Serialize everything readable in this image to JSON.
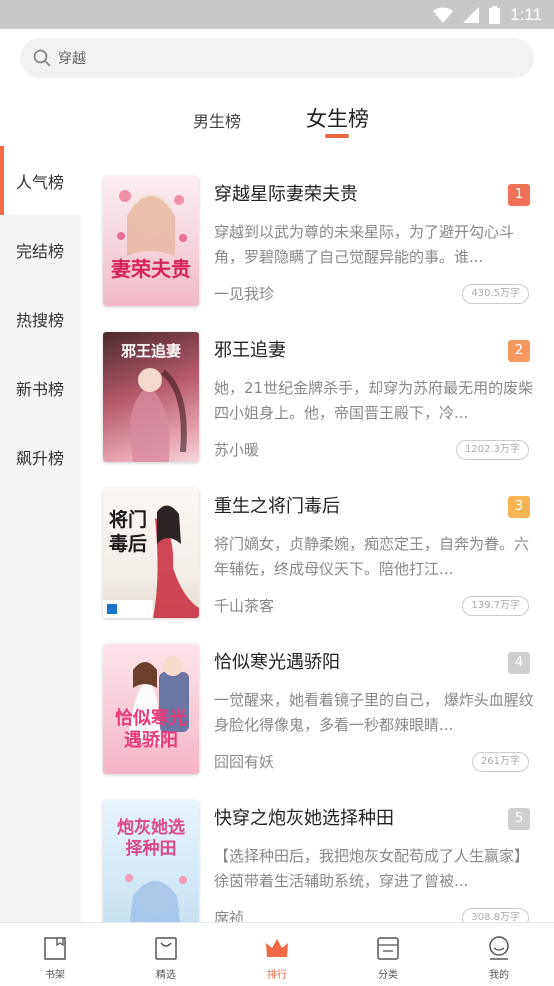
{
  "status_bar": {
    "time": "1:11"
  },
  "search": {
    "placeholder": "穿越"
  },
  "tabs": [
    {
      "label": "男生榜",
      "active": false
    },
    {
      "label": "女生榜",
      "active": true
    }
  ],
  "sidebar": {
    "items": [
      {
        "label": "人气榜",
        "active": true
      },
      {
        "label": "完结榜",
        "active": false
      },
      {
        "label": "热搜榜",
        "active": false
      },
      {
        "label": "新书榜",
        "active": false
      },
      {
        "label": "飙升榜",
        "active": false
      }
    ]
  },
  "books": [
    {
      "rank": "1",
      "title": "穿越星际妻荣夫贵",
      "description": "穿越到以武为尊的未来星际，为了避开勾心斗角，罗碧隐瞒了自己觉醒异能的事。谁...",
      "author": "一见我珍",
      "count": "430.5万字",
      "cover_title": "妻荣夫贵",
      "rank_color": "#f0715a"
    },
    {
      "rank": "2",
      "title": "邪王追妻",
      "description": "她，21世纪金牌杀手，却穿为苏府最无用的废柴四小姐身上。他，帝国晋王殿下，冷...",
      "author": "苏小暖",
      "count": "1202.3万字",
      "cover_title": "邪王追妻",
      "rank_color": "#f49a5e"
    },
    {
      "rank": "3",
      "title": "重生之将门毒后",
      "description": "将门嫡女，贞静柔婉，痴恋定王，自奔为眷。六年辅佐，终成母仪天下。陪他打江...",
      "author": "千山茶客",
      "count": "139.7万字",
      "cover_title": "将门毒后",
      "rank_color": "#f6b456"
    },
    {
      "rank": "4",
      "title": "恰似寒光遇骄阳",
      "description": "一觉醒来，她看着镜子里的自己， 爆炸头血腥纹身脸化得像鬼，多看一秒都辣眼睛...",
      "author": "囧囧有妖",
      "count": "261万字",
      "cover_title": "恰似寒光遇骄阳",
      "rank_color": "#cfcfcf"
    },
    {
      "rank": "5",
      "title": "快穿之炮灰她选择种田",
      "description": "【选择种田后，我把炮灰女配苟成了人生赢家】徐茵带着生活辅助系统，穿进了曾被...",
      "author": "席祯",
      "count": "308.8万字",
      "cover_title": "炮灰她选择种田",
      "rank_color": "#cfcfcf"
    }
  ],
  "bottom_nav": [
    {
      "label": "书架",
      "icon": "bookshelf-icon",
      "active": false
    },
    {
      "label": "精选",
      "icon": "featured-icon",
      "active": false
    },
    {
      "label": "排行",
      "icon": "crown-icon",
      "active": true
    },
    {
      "label": "分类",
      "icon": "category-icon",
      "active": false
    },
    {
      "label": "我的",
      "icon": "profile-icon",
      "active": false
    }
  ],
  "colors": {
    "accent": "#f06a45",
    "sidebar_bg": "#f5f5f5",
    "status_bar": "#c8c8c8"
  }
}
